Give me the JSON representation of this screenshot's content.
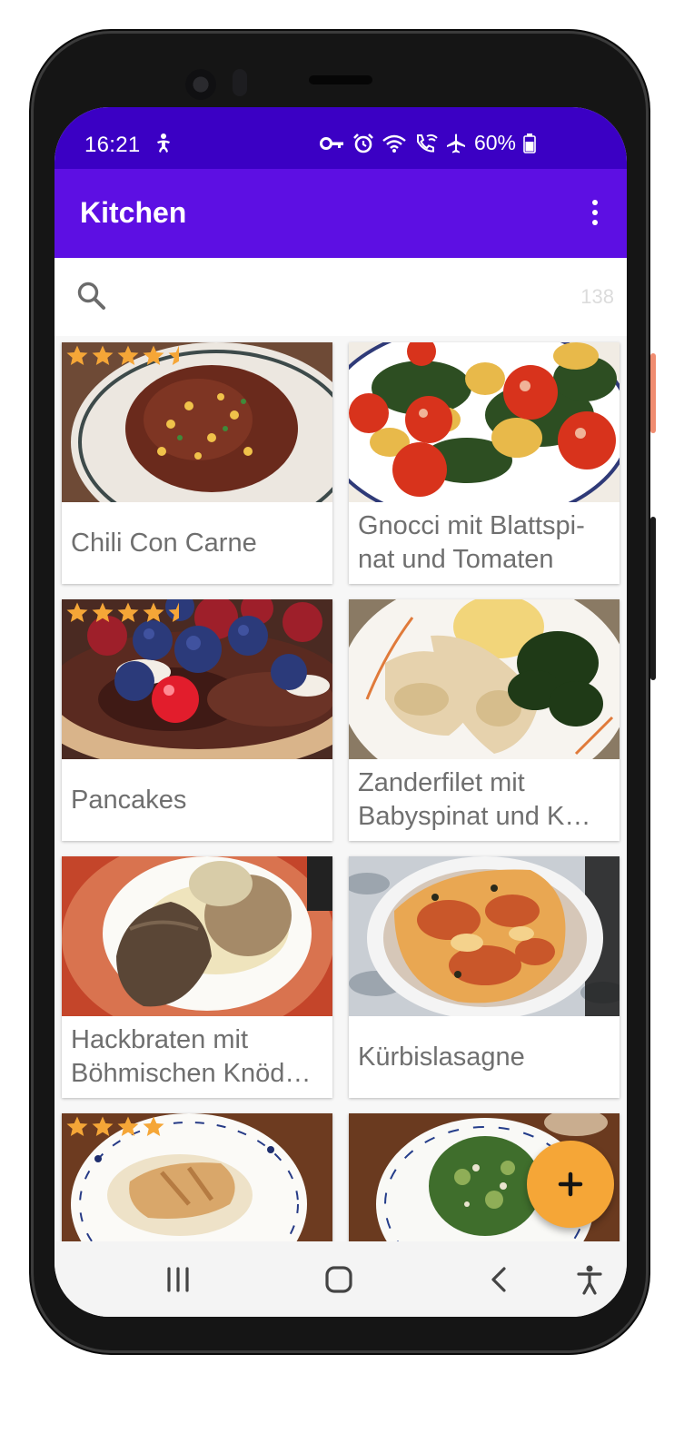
{
  "status": {
    "time": "16:21",
    "battery": "60%",
    "icons": [
      "accessibility-icon",
      "vpn-key-icon",
      "alarm-icon",
      "wifi-icon",
      "wifi-calling-icon",
      "airplane-icon",
      "battery-icon"
    ]
  },
  "appbar": {
    "title": "Kitchen",
    "menu_icon": "more-vertical-icon"
  },
  "search": {
    "placeholder": "",
    "value": "",
    "count": "138"
  },
  "recipes": [
    {
      "title": "Chili Con Carne",
      "rating": 4.5
    },
    {
      "title": "Gnocci mit Blattspi-nat und Tomaten",
      "rating": 0
    },
    {
      "title": "Pancakes",
      "rating": 4.5
    },
    {
      "title": "Zanderfilet mit Babyspinat und K…",
      "rating": 0
    },
    {
      "title": "Hackbraten mit Böhmischen Knöd…",
      "rating": 0
    },
    {
      "title": "Kürbislasagne",
      "rating": 0
    },
    {
      "title": "",
      "rating": 4
    },
    {
      "title": "",
      "rating": 0
    }
  ],
  "fab": {
    "icon": "plus-icon"
  },
  "navbar": {
    "icons": [
      "recent-apps-icon",
      "home-icon",
      "back-icon",
      "accessibility-icon"
    ]
  },
  "colors": {
    "status_bar": "#3b00c4",
    "app_bar": "#5d0fe3",
    "fab": "#f5a637",
    "star": "#f5a637"
  }
}
